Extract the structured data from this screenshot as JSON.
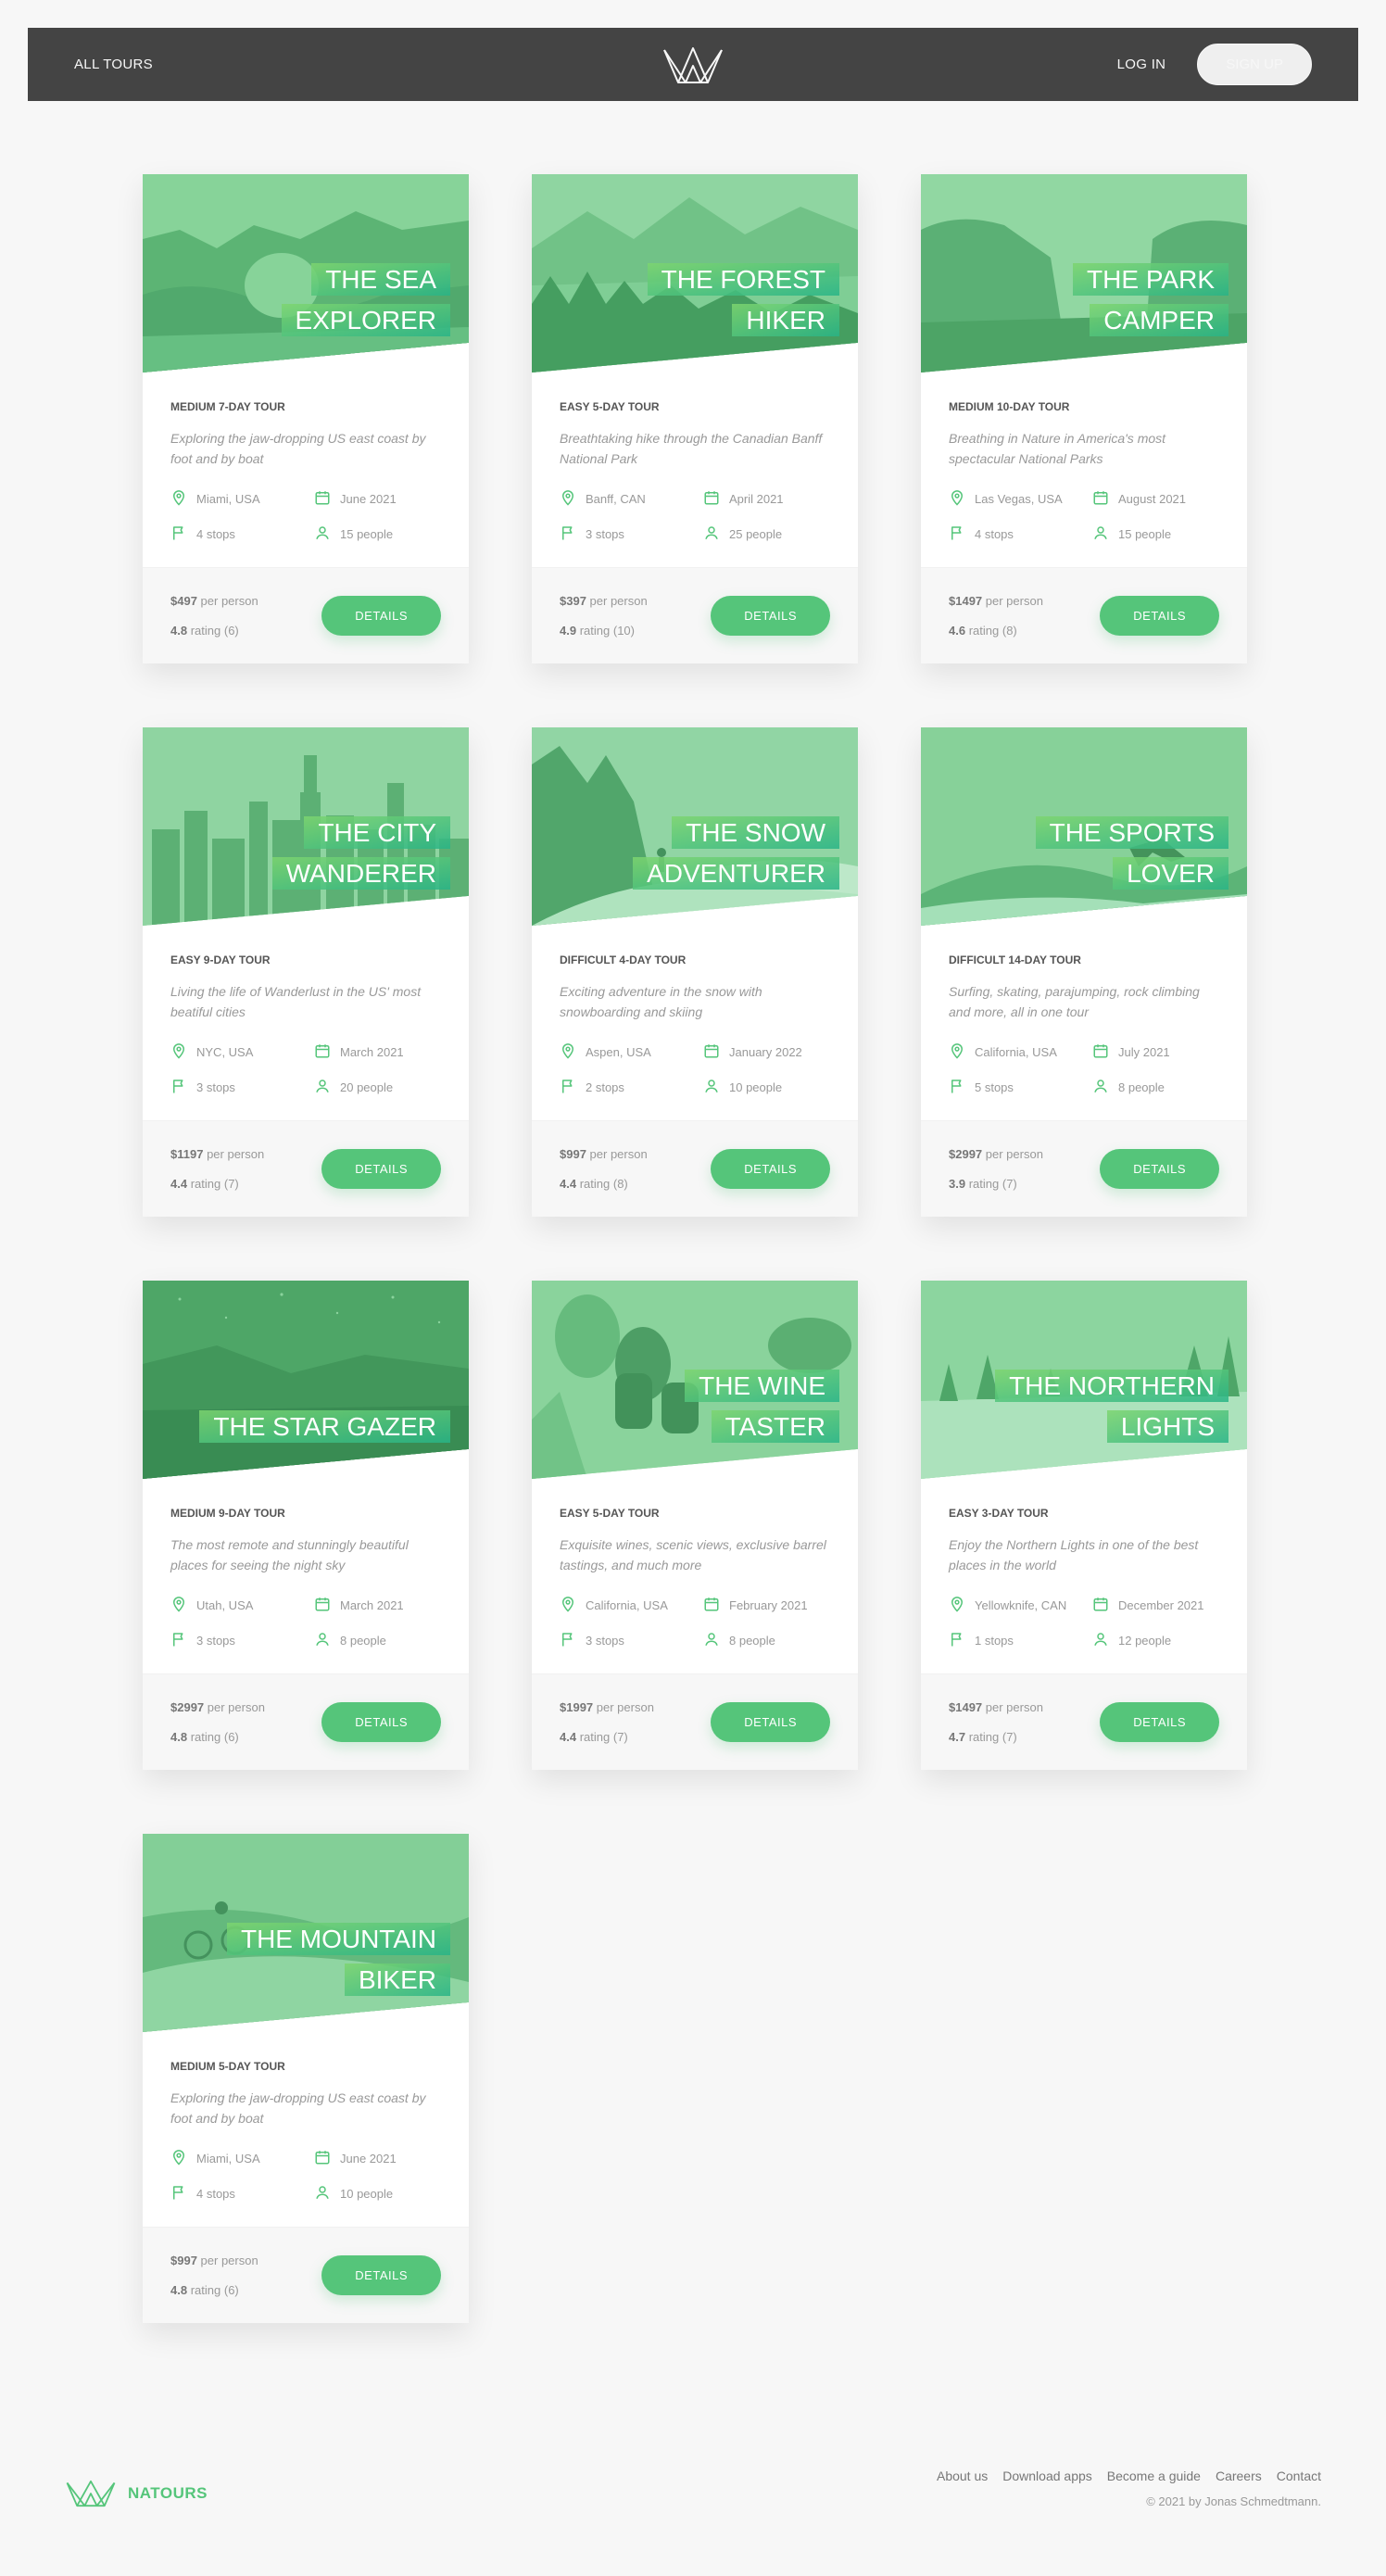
{
  "header": {
    "all_tours": "All tours",
    "login": "Log in",
    "signup": "Sign up"
  },
  "labels": {
    "per_person": "per person",
    "rating": "rating",
    "details": "Details"
  },
  "colors": {
    "primary": "#55c57a",
    "header_bg": "#444444",
    "page_bg": "#f7f7f7"
  },
  "tours": [
    {
      "title_1": "The Sea",
      "title_2": "Explorer",
      "subheading": "Medium 7-day tour",
      "summary": "Exploring the jaw-dropping US east coast by foot and by boat",
      "location": "Miami, USA",
      "date": "June 2021",
      "stops": "4 stops",
      "people": "15 people",
      "price": "$497",
      "rating": "4.8",
      "count": "(6)",
      "scene": "sea"
    },
    {
      "title_1": "The Forest",
      "title_2": "Hiker",
      "subheading": "Easy 5-day tour",
      "summary": "Breathtaking hike through the Canadian Banff National Park",
      "location": "Banff, CAN",
      "date": "April 2021",
      "stops": "3 stops",
      "people": "25 people",
      "price": "$397",
      "rating": "4.9",
      "count": "(10)",
      "scene": "forest"
    },
    {
      "title_1": "The Park",
      "title_2": "Camper",
      "subheading": "Medium 10-day tour",
      "summary": "Breathing in Nature in America's most spectacular National Parks",
      "location": "Las Vegas, USA",
      "date": "August 2021",
      "stops": "4 stops",
      "people": "15 people",
      "price": "$1497",
      "rating": "4.6",
      "count": "(8)",
      "scene": "park"
    },
    {
      "title_1": "The City",
      "title_2": "Wanderer",
      "subheading": "Easy 9-day tour",
      "summary": "Living the life of Wanderlust in the US' most beatiful cities",
      "location": "NYC, USA",
      "date": "March 2021",
      "stops": "3 stops",
      "people": "20 people",
      "price": "$1197",
      "rating": "4.4",
      "count": "(7)",
      "scene": "city"
    },
    {
      "title_1": "The Snow",
      "title_2": "Adventurer",
      "subheading": "Difficult 4-day tour",
      "summary": "Exciting adventure in the snow with snowboarding and skiing",
      "location": "Aspen, USA",
      "date": "January 2022",
      "stops": "2 stops",
      "people": "10 people",
      "price": "$997",
      "rating": "4.4",
      "count": "(8)",
      "scene": "snow"
    },
    {
      "title_1": "The Sports",
      "title_2": "Lover",
      "subheading": "Difficult 14-day tour",
      "summary": "Surfing, skating, parajumping, rock climbing and more, all in one tour",
      "location": "California, USA",
      "date": "July 2021",
      "stops": "5 stops",
      "people": "8 people",
      "price": "$2997",
      "rating": "3.9",
      "count": "(7)",
      "scene": "sports"
    },
    {
      "title_1": "The Star Gazer",
      "title_2": "",
      "subheading": "Medium 9-day tour",
      "summary": "The most remote and stunningly beautiful places for seeing the night sky",
      "location": "Utah, USA",
      "date": "March 2021",
      "stops": "3 stops",
      "people": "8 people",
      "price": "$2997",
      "rating": "4.8",
      "count": "(6)",
      "scene": "star"
    },
    {
      "title_1": "The Wine",
      "title_2": "Taster",
      "subheading": "Easy 5-day tour",
      "summary": "Exquisite wines, scenic views, exclusive barrel tastings, and much more",
      "location": "California, USA",
      "date": "February 2021",
      "stops": "3 stops",
      "people": "8 people",
      "price": "$1997",
      "rating": "4.4",
      "count": "(7)",
      "scene": "wine"
    },
    {
      "title_1": "The Northern",
      "title_2": "Lights",
      "subheading": "Easy 3-day tour",
      "summary": "Enjoy the Northern Lights in one of the best places in the world",
      "location": "Yellowknife, CAN",
      "date": "December 2021",
      "stops": "1 stops",
      "people": "12 people",
      "price": "$1497",
      "rating": "4.7",
      "count": "(7)",
      "scene": "northern"
    },
    {
      "title_1": "The Mountain",
      "title_2": "Biker",
      "subheading": "Medium 5-day tour",
      "summary": "Exploring the jaw-dropping US east coast by foot and by boat",
      "location": "Miami, USA",
      "date": "June 2021",
      "stops": "4 stops",
      "people": "10 people",
      "price": "$997",
      "rating": "4.8",
      "count": "(6)",
      "scene": "biker"
    }
  ],
  "footer": {
    "brand": "NATOURS",
    "nav": [
      "About us",
      "Download apps",
      "Become a guide",
      "Careers",
      "Contact"
    ],
    "copyright": "© 2021 by Jonas Schmedtmann."
  }
}
